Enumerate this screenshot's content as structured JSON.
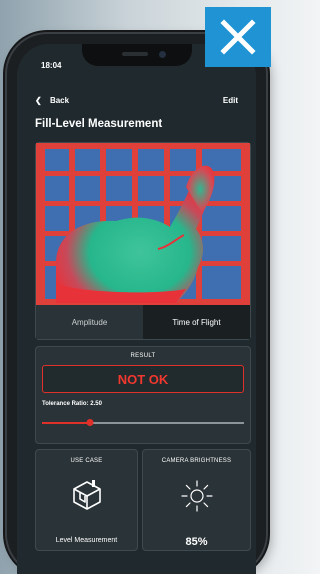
{
  "status": {
    "time": "18:04",
    "icons": "▮▮ ◔"
  },
  "nav": {
    "back_label": "Back",
    "edit_label": "Edit"
  },
  "page": {
    "title": "Fill-Level Measurement"
  },
  "viewer": {
    "tabs": [
      {
        "label": "Amplitude",
        "active": false
      },
      {
        "label": "Time of Flight",
        "active": true
      }
    ]
  },
  "result": {
    "label": "RESULT",
    "value": "NOT OK",
    "color": "#e0302a"
  },
  "tolerance": {
    "label": "Tolerance Ratio: 2.50",
    "slider_fraction": 0.24
  },
  "use_case": {
    "label": "USE CASE",
    "value": "Level Measurement",
    "icon": "box-level-icon"
  },
  "camera_brightness": {
    "label": "CAMERA BRIGHTNESS",
    "value": "85%",
    "icon": "sun-icon"
  },
  "overlay": {
    "close_icon": "close-icon",
    "color": "#1f93d3"
  }
}
